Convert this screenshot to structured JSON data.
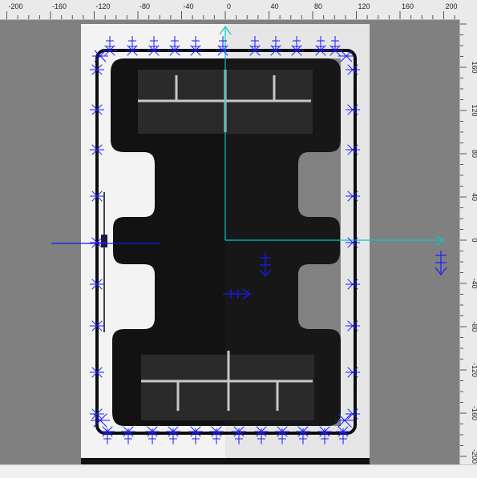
{
  "ruler": {
    "horizontal_labels": [
      "-200",
      "-160",
      "-120",
      "-80",
      "-40",
      "0",
      "40",
      "80",
      "120",
      "160",
      "200"
    ],
    "vertical_labels": [
      "160",
      "120",
      "80",
      "40",
      "0",
      "-40",
      "-80",
      "-120",
      "-160",
      "-200"
    ]
  },
  "colors": {
    "canvas_bg": "#808080",
    "axis_x": "#00c8c8",
    "axis_y": "#00c8c8",
    "marker": "#1a1aff",
    "part": "#0d0d0d",
    "image_bg": "#f2f2f2"
  },
  "icons": [
    "crosshair-marker-icon",
    "origin-axis-x-arrow-icon",
    "origin-axis-y-arrow-icon"
  ]
}
